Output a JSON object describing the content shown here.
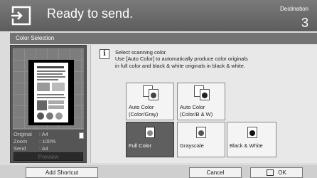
{
  "header": {
    "title": "Ready to send.",
    "destination_label": "Destination",
    "destination_count": "3",
    "icon": "send-icon"
  },
  "subtitle": "Color Selection",
  "preview": {
    "original_label": "Original",
    "original_value": ": A4",
    "zoom_label": "Zoom",
    "zoom_value": ": 100%",
    "send_label": "Send",
    "send_value": ": A4",
    "button_label": "Preview"
  },
  "message": {
    "icon": "info-icon",
    "line1": "Select scanning color.",
    "line2": "Use [Auto Color] to automatically produce color originals",
    "line3": "in full color and black & white originals in black & white."
  },
  "options": {
    "auto_color_gray": {
      "line1": "Auto Color",
      "line2": "(Color/Gray)"
    },
    "auto_color_bw": {
      "line1": "Auto Color",
      "line2": "(Color/B & W)"
    },
    "full_color": "Full Color",
    "grayscale": "Grayscale",
    "black_white": "Black & White",
    "selected": "Full Color"
  },
  "bottom": {
    "add_shortcut": "Add Shortcut",
    "cancel": "Cancel",
    "ok": "OK"
  },
  "colors": {
    "header_bg": "#6a6a6a",
    "selected_bg": "#5f5f5f"
  }
}
